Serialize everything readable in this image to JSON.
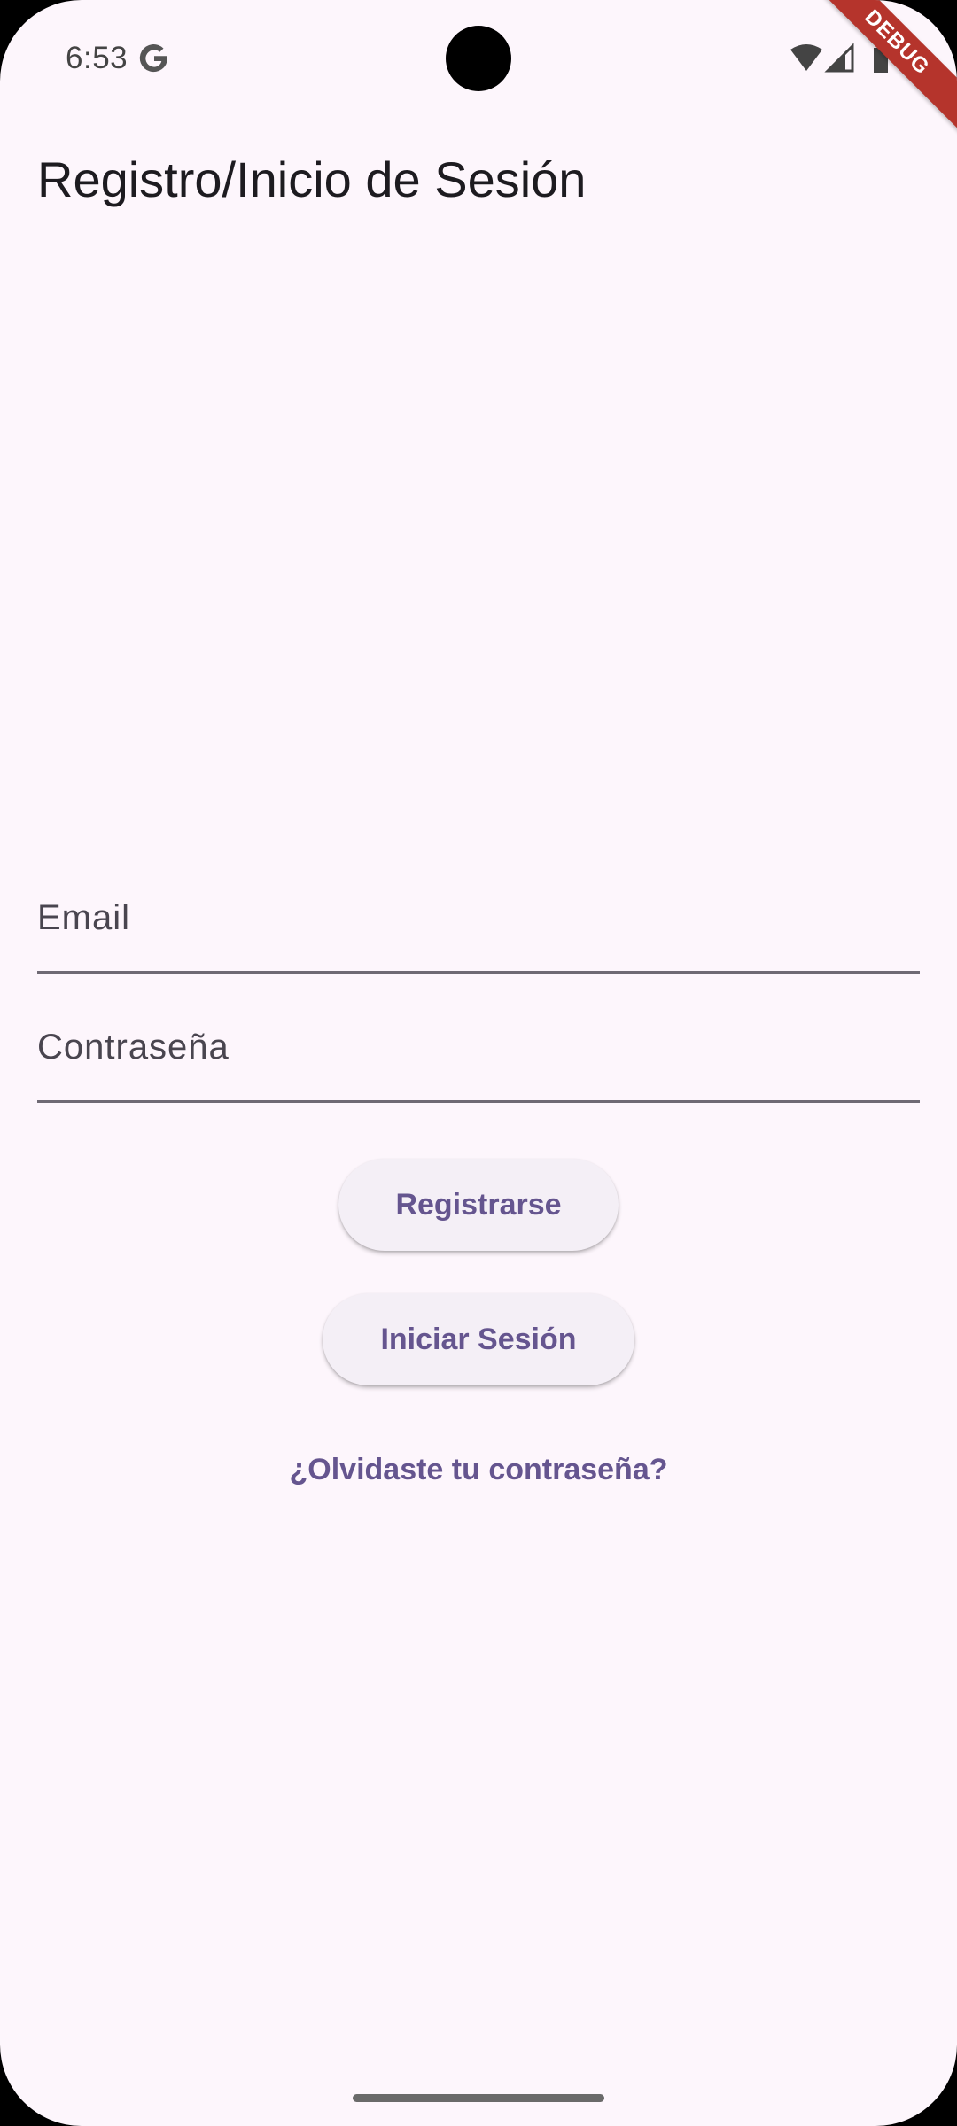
{
  "status_bar": {
    "time": "6:53",
    "left_icon": "google-g-icon",
    "right_icons": [
      "wifi-icon",
      "signal-icon",
      "battery-icon"
    ]
  },
  "debug_banner": "DEBUG",
  "app_bar": {
    "title": "Registro/Inicio de Sesión"
  },
  "form": {
    "email_placeholder": "Email",
    "password_placeholder": "Contraseña",
    "register_label": "Registrarse",
    "login_label": "Iniciar Sesión",
    "forgot_label": "¿Olvidaste tu contraseña?"
  },
  "colors": {
    "background": "#fdf6fc",
    "accent": "#65558f",
    "button_surface": "#f4eff6",
    "debug_banner": "#b5342c"
  }
}
